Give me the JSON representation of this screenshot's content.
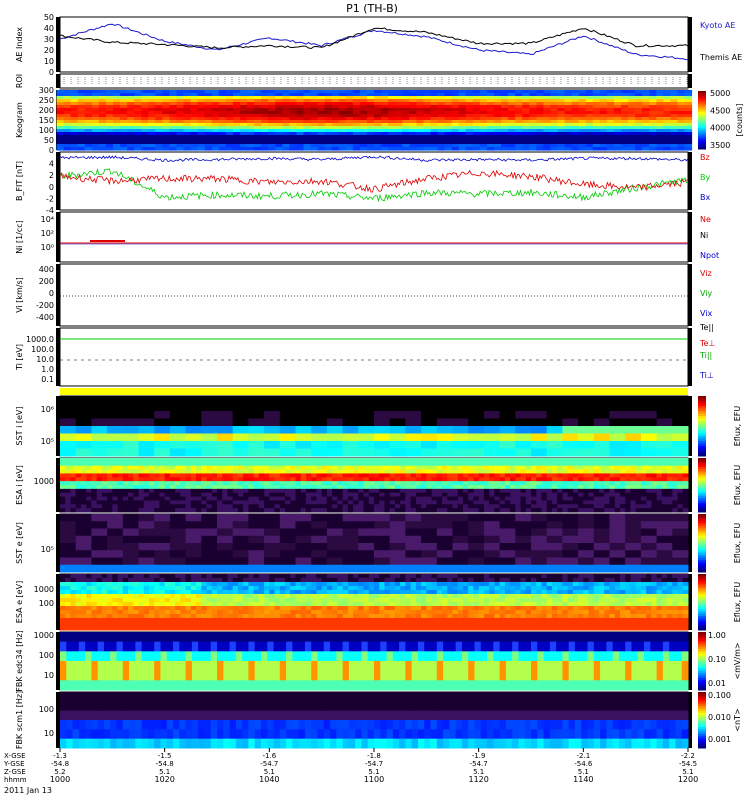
{
  "title": "P1 (TH-B)",
  "date_label": "2011 Jan 13",
  "x_axis": {
    "tick_labels": [
      "1000",
      "1020",
      "1040",
      "1100",
      "1120",
      "1140",
      "1200"
    ],
    "row_labels": [
      "X-GSE",
      "Y-GSE",
      "Z-GSE",
      "hhmm"
    ],
    "row_values": {
      "X-GSE": [
        "-1.3",
        "-1.5",
        "-1.6",
        "-1.8",
        "-1.9",
        "-2.1",
        "-2.2"
      ],
      "Y-GSE": [
        "-54.8",
        "-54.8",
        "-54.7",
        "-54.7",
        "-54.7",
        "-54.6",
        "-54.5"
      ],
      "Z-GSE": [
        "5.2",
        "5.1",
        "5.1",
        "5.1",
        "5.1",
        "5.1",
        "5.1"
      ]
    }
  },
  "panels": [
    {
      "id": "ae",
      "ylabel": "AE Index",
      "right_labels": [
        "Kyoto AE",
        "Themis AE"
      ]
    },
    {
      "id": "roi",
      "ylabel": "ROI"
    },
    {
      "id": "keogram",
      "ylabel": "Keogram",
      "colorbar_ticks": [
        "5000",
        "4500",
        "4000",
        "3500"
      ],
      "colorbar_unit": "[counts]"
    },
    {
      "id": "bfit",
      "ylabel": "B_FIT [nT]",
      "right_labels": [
        "Bz",
        "By",
        "Bx"
      ]
    },
    {
      "id": "ni",
      "ylabel": "Ni [1/cc]",
      "right_labels": [
        "Ne",
        "Ni",
        "Npot"
      ]
    },
    {
      "id": "vi",
      "ylabel": "Vi [km/s]",
      "right_labels": [
        "Viz",
        "Viy",
        "Vix"
      ]
    },
    {
      "id": "ti",
      "ylabel": "Ti [eV]",
      "right_labels": [
        "Te||",
        "Te⊥",
        "Ti||",
        "Ti⊥"
      ]
    },
    {
      "id": "sst1",
      "ylabel": "SST i [eV]",
      "colorbar_label": "Eflux, EFU"
    },
    {
      "id": "esa1",
      "ylabel": "ESA i [eV]",
      "colorbar_label": "Eflux, EFU"
    },
    {
      "id": "sst2",
      "ylabel": "SST e [eV]",
      "colorbar_label": "Eflux, EFU"
    },
    {
      "id": "esa2",
      "ylabel": "ESA e [eV]",
      "colorbar_label": "Eflux, EFU"
    },
    {
      "id": "fbk1",
      "ylabel": "FBK edc34 [Hz]",
      "colorbar_ticks": [
        "1.00",
        "0.10",
        "0.01"
      ],
      "colorbar_label": "<mV/m>"
    },
    {
      "id": "fbk2",
      "ylabel": "FBK scm1 [Hz]",
      "colorbar_ticks": [
        "0.100",
        "0.010",
        "0.001"
      ],
      "colorbar_label": "<nT>"
    }
  ],
  "colors": {
    "kyoto": "#1a1acc",
    "themis": "#000000",
    "bz": "#dd0000",
    "by": "#00cc00",
    "bx": "#0000cc"
  },
  "chart_data": [
    {
      "type": "line",
      "title": "AE Index",
      "x": [
        "1000",
        "1010",
        "1020",
        "1030",
        "1040",
        "1050",
        "1100",
        "1110",
        "1120",
        "1130",
        "1140",
        "1150",
        "1200"
      ],
      "ylim": [
        0,
        50
      ],
      "yticks": [
        0,
        10,
        20,
        30,
        40,
        50
      ],
      "series": [
        {
          "name": "Kyoto AE",
          "values": [
            30,
            44,
            28,
            20,
            31,
            24,
            38,
            32,
            20,
            16,
            33,
            16,
            12
          ]
        },
        {
          "name": "Themis AE",
          "values": [
            33,
            27,
            25,
            22,
            24,
            22,
            40,
            36,
            26,
            26,
            40,
            24,
            24
          ]
        }
      ]
    },
    {
      "type": "line",
      "title": "B_FIT",
      "x": [
        "1000",
        "1010",
        "1020",
        "1030",
        "1040",
        "1050",
        "1100",
        "1110",
        "1120",
        "1130",
        "1140",
        "1150",
        "1200"
      ],
      "ylim": [
        -4,
        6
      ],
      "yticks": [
        -4,
        -2,
        0,
        2,
        4
      ],
      "series": [
        {
          "name": "Bx",
          "values": [
            5.0,
            5.1,
            4.6,
            4.7,
            4.9,
            4.7,
            5.2,
            4.6,
            4.7,
            4.6,
            4.9,
            4.9,
            4.6
          ]
        },
        {
          "name": "By",
          "values": [
            1.8,
            2.8,
            -1.8,
            -1.4,
            -1.6,
            -1.2,
            -2.0,
            -1.0,
            -1.2,
            -1.0,
            -1.8,
            -0.2,
            1.2
          ]
        },
        {
          "name": "Bz",
          "values": [
            1.8,
            1.0,
            1.4,
            1.4,
            0.8,
            1.0,
            -0.4,
            1.4,
            2.4,
            1.8,
            0.4,
            -0.2,
            0.8
          ]
        }
      ]
    },
    {
      "type": "heatmap",
      "title": "Keogram",
      "y_ticks": [
        0,
        50,
        100,
        150,
        200,
        250,
        300
      ],
      "values_range": [
        3500,
        5000
      ]
    },
    {
      "type": "heatmap",
      "title": "SST",
      "y_ticks": [
        "10^5",
        "10^6"
      ]
    },
    {
      "type": "heatmap",
      "title": "ESA",
      "y_ticks": [
        "1000"
      ]
    },
    {
      "type": "heatmap",
      "title": "ESA electron",
      "y_ticks": [
        "100",
        "1000"
      ]
    },
    {
      "type": "heatmap",
      "title": "FBK",
      "y_ticks": [
        "10",
        "100",
        "1000"
      ]
    }
  ]
}
